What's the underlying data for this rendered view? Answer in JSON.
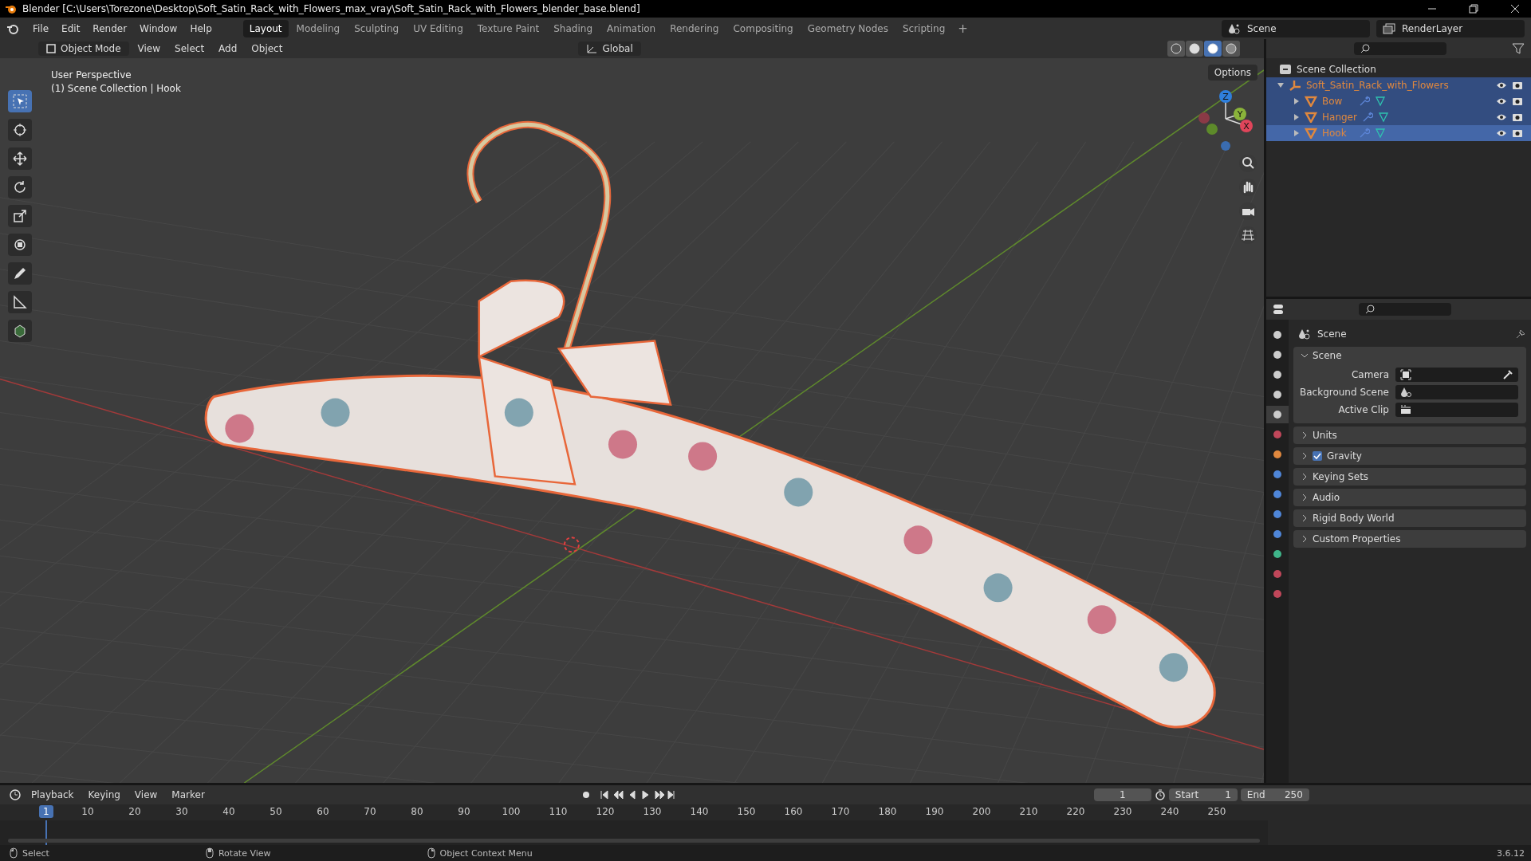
{
  "window": {
    "title": "Blender [C:\\Users\\Torezone\\Desktop\\Soft_Satin_Rack_with_Flowers_max_vray\\Soft_Satin_Rack_with_Flowers_blender_base.blend]"
  },
  "menu": [
    "File",
    "Edit",
    "Render",
    "Window",
    "Help"
  ],
  "workspaces": [
    {
      "label": "Layout",
      "selected": true
    },
    {
      "label": "Modeling",
      "selected": false
    },
    {
      "label": "Sculpting",
      "selected": false
    },
    {
      "label": "UV Editing",
      "selected": false
    },
    {
      "label": "Texture Paint",
      "selected": false
    },
    {
      "label": "Shading",
      "selected": false
    },
    {
      "label": "Animation",
      "selected": false
    },
    {
      "label": "Rendering",
      "selected": false
    },
    {
      "label": "Compositing",
      "selected": false
    },
    {
      "label": "Geometry Nodes",
      "selected": false
    },
    {
      "label": "Scripting",
      "selected": false
    }
  ],
  "add_workspace": "+",
  "scene_selector": {
    "scene": "Scene",
    "view_layer": "RenderLayer"
  },
  "viewport": {
    "mode": "Object Mode",
    "menus": [
      "View",
      "Select",
      "Add",
      "Object"
    ],
    "orientation": "Global",
    "options": "Options",
    "shading": [
      {
        "kind": "wireframe",
        "selected": false
      },
      {
        "kind": "solid",
        "selected": false
      },
      {
        "kind": "material",
        "selected": true
      },
      {
        "kind": "rendered",
        "selected": false
      }
    ],
    "overlay_text": [
      "User Perspective",
      "(1) Scene Collection | Hook"
    ],
    "tools": [
      {
        "kind": "select",
        "selected": true
      },
      {
        "kind": "cursor",
        "selected": false
      },
      {
        "kind": "move",
        "selected": false
      },
      {
        "kind": "rotate",
        "selected": false
      },
      {
        "kind": "scale",
        "selected": false
      },
      {
        "kind": "transform",
        "selected": false
      },
      {
        "kind": "annotate",
        "selected": false
      },
      {
        "kind": "measure",
        "selected": false
      },
      {
        "kind": "add",
        "selected": false
      }
    ],
    "gizmo": [
      "Z",
      "Y",
      "X"
    ]
  },
  "outliner": {
    "root": "Scene Collection",
    "items": [
      {
        "name": "Soft_Satin_Rack_with_Flowers",
        "kind": "empty",
        "selected": true,
        "active": false,
        "expanded": true,
        "children": [
          {
            "name": "Bow",
            "kind": "mesh",
            "selected": true,
            "active": false,
            "expanded": false
          },
          {
            "name": "Hanger",
            "kind": "mesh",
            "selected": true,
            "active": false,
            "expanded": false
          },
          {
            "name": "Hook",
            "kind": "mesh",
            "selected": true,
            "active": true,
            "expanded": false
          }
        ]
      }
    ]
  },
  "properties": {
    "tabs": [
      {
        "kind": "tool",
        "selected": false
      },
      {
        "kind": "render",
        "selected": false
      },
      {
        "kind": "output",
        "selected": false
      },
      {
        "kind": "view_layer",
        "selected": false
      },
      {
        "kind": "scene",
        "selected": true
      },
      {
        "kind": "world",
        "selected": false
      },
      {
        "kind": "object",
        "selected": false
      },
      {
        "kind": "modifier",
        "selected": false
      },
      {
        "kind": "particles",
        "selected": false
      },
      {
        "kind": "physics",
        "selected": false
      },
      {
        "kind": "constraints",
        "selected": false
      },
      {
        "kind": "data",
        "selected": false
      },
      {
        "kind": "material",
        "selected": false
      },
      {
        "kind": "texture",
        "selected": false
      }
    ],
    "context": "Scene",
    "panels": [
      {
        "title": "Scene",
        "expanded": true,
        "fields": [
          {
            "label": "Camera",
            "kind": "camera"
          },
          {
            "label": "Background Scene",
            "kind": "scene"
          },
          {
            "label": "Active Clip",
            "kind": "clip"
          }
        ]
      },
      {
        "title": "Units",
        "expanded": false
      },
      {
        "title": "Gravity",
        "expanded": false,
        "checked": true
      },
      {
        "title": "Keying Sets",
        "expanded": false
      },
      {
        "title": "Audio",
        "expanded": false
      },
      {
        "title": "Rigid Body World",
        "expanded": false
      },
      {
        "title": "Custom Properties",
        "expanded": false
      }
    ]
  },
  "timeline": {
    "menus": [
      "Playback",
      "Keying",
      "View",
      "Marker"
    ],
    "current_frame": "1",
    "start_label": "Start",
    "start": "1",
    "end_label": "End",
    "end": "250",
    "playhead": "1",
    "ticks": [
      "10",
      "20",
      "30",
      "40",
      "50",
      "60",
      "70",
      "80",
      "90",
      "100",
      "110",
      "120",
      "130",
      "140",
      "150",
      "160",
      "170",
      "180",
      "190",
      "200",
      "210",
      "220",
      "230",
      "240",
      "250"
    ]
  },
  "status_bar": {
    "hints": [
      "Select",
      "Rotate View",
      "Object Context Menu"
    ],
    "version": "3.6.12"
  }
}
